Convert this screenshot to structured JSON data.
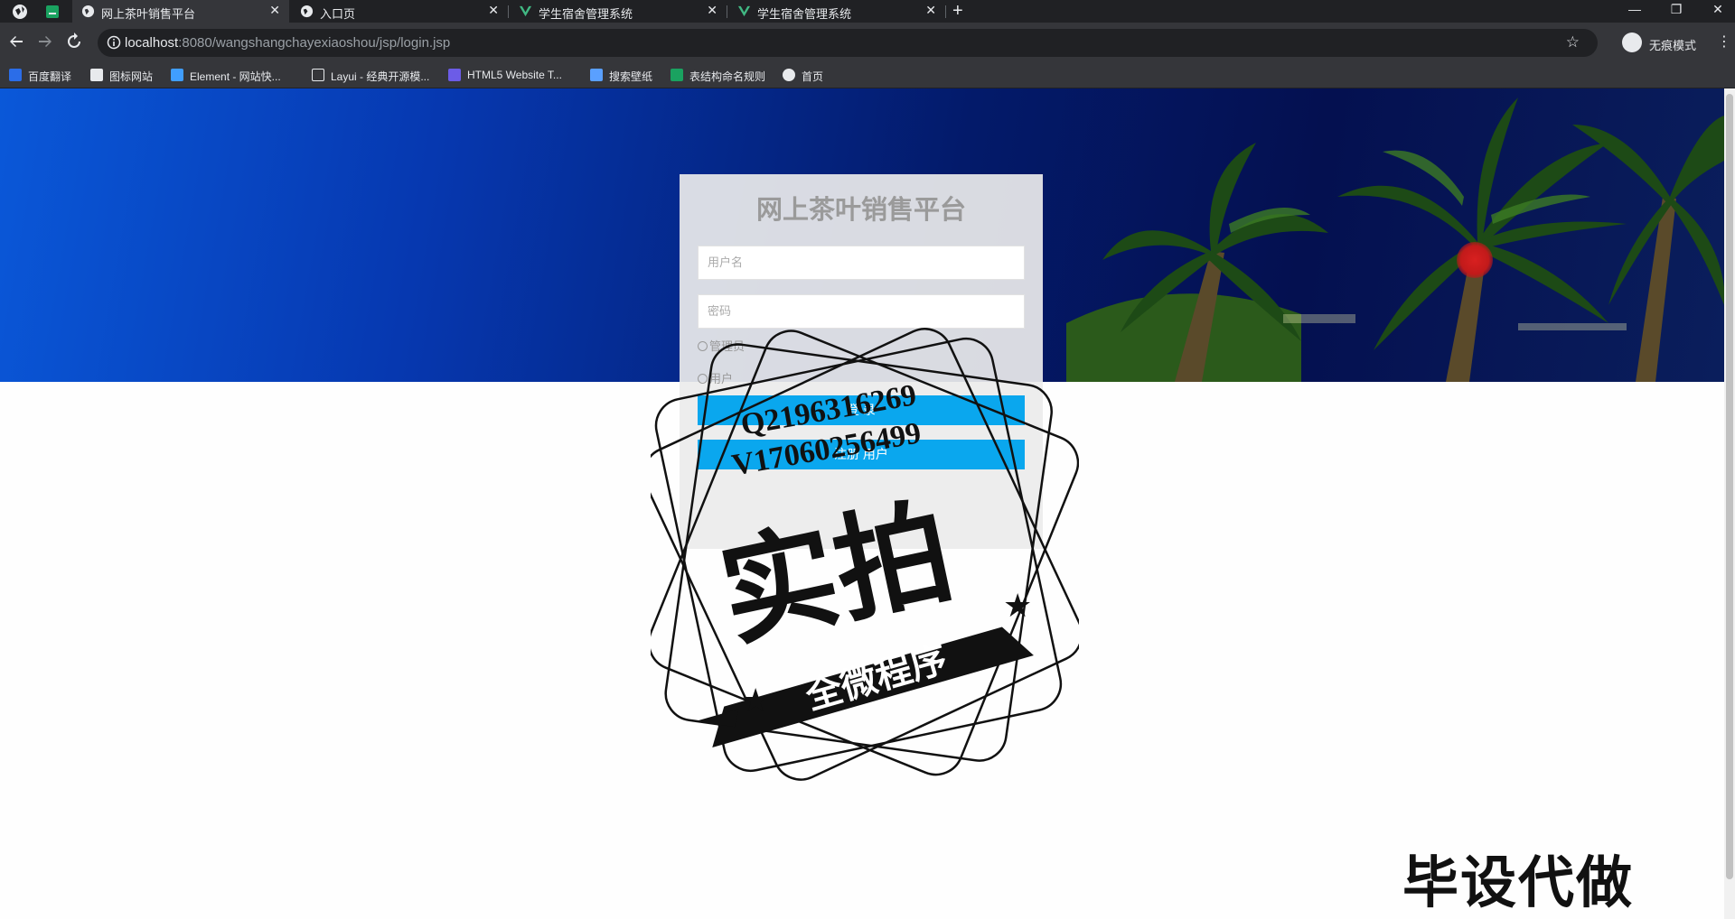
{
  "browser": {
    "tabs": [
      {
        "label": "网上茶叶销售平台",
        "active": true
      },
      {
        "label": "入口页",
        "active": false
      },
      {
        "label": "学生宿舍管理系统",
        "active": false
      },
      {
        "label": "学生宿舍管理系统",
        "active": false
      }
    ],
    "url_host": "localhost",
    "url_rest": ":8080/wangshangchayexiaoshou/jsp/login.jsp",
    "incognito_label": "无痕模式",
    "bookmarks": [
      {
        "label": "百度翻译",
        "color": "#2b6de8"
      },
      {
        "label": "图标网站",
        "color": "#e8eaed"
      },
      {
        "label": "Element - 网站快...",
        "color": "#409eff"
      },
      {
        "label": "Layui - 经典开源模...",
        "color": "#e8eaed"
      },
      {
        "label": "HTML5 Website T...",
        "color": "#6c5ce7"
      },
      {
        "label": "搜索壁纸",
        "color": "#5aa0ff"
      },
      {
        "label": "表结构命名规则",
        "color": "#1aa260"
      },
      {
        "label": "首页",
        "color": "#e8eaed"
      }
    ]
  },
  "login": {
    "title": "网上茶叶销售平台",
    "username_placeholder": "用户名",
    "password_placeholder": "密码",
    "roles": [
      "管理员",
      "用户"
    ],
    "login_button": "登 录",
    "register_button": "注册 用户"
  },
  "watermark": {
    "qq": "Q2196316269",
    "vx": "V17060256499",
    "big": "实拍",
    "ribbon": "全微程序",
    "corner": "毕设代做"
  },
  "colors": {
    "chrome_dark": "#202124",
    "chrome_mid": "#35363a",
    "accent": "#0aa7ee"
  }
}
